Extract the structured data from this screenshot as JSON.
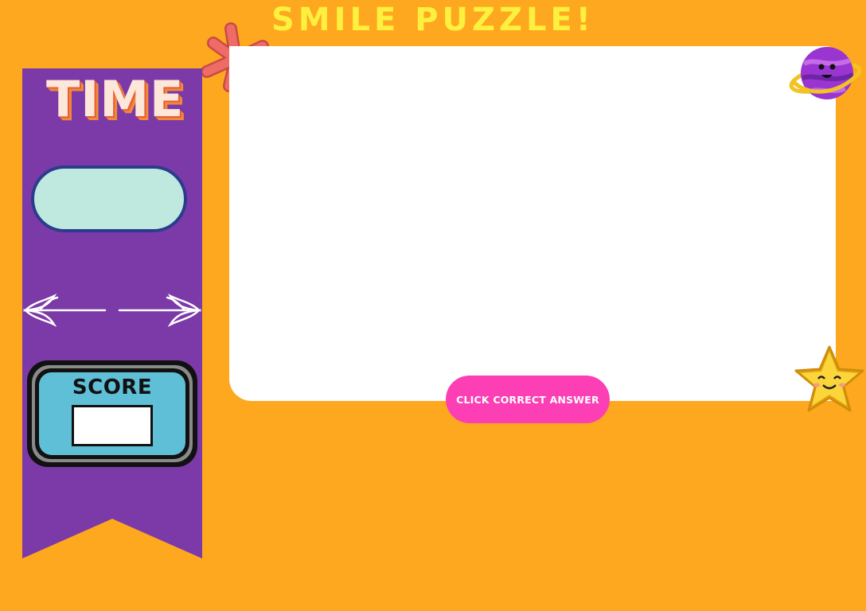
{
  "game": {
    "title": "SMILE PUZZLE!"
  },
  "sidebar": {
    "time_label": "TIME",
    "timer_value": "",
    "score_label": "SCORE",
    "score_value": ""
  },
  "board": {
    "answer_button_label": "CLICK CORRECT ANSWER"
  },
  "decorations": {
    "icons": [
      "asterisk-sticker-icon",
      "planet-sticker-icon",
      "star-sticker-icon",
      "leaf-arrow-divider-icon"
    ]
  },
  "colors": {
    "background": "#fea81f",
    "title": "#fdf03e",
    "sidebar": "#7b3aa7",
    "timer_fill": "#bfe9df",
    "timer_border": "#2b3c8c",
    "score_panel": "#5fbfd6",
    "button": "#fc3fb4"
  }
}
